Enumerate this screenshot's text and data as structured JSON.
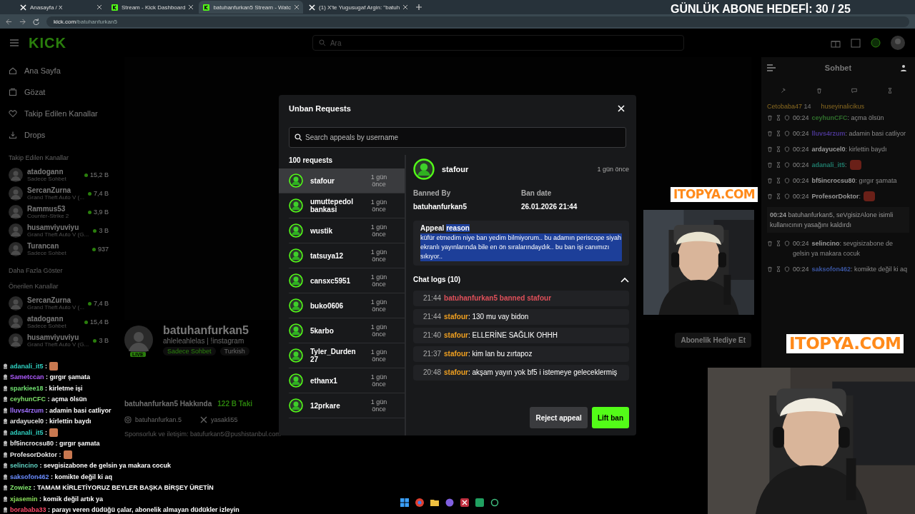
{
  "browser": {
    "tabs": [
      {
        "title": "Anasayfa / X",
        "kind": "x",
        "selected": false
      },
      {
        "title": "Stream - Kick Dashboard",
        "kind": "kick",
        "selected": false
      },
      {
        "title": "batuhanfurkan5 Stream - Watc",
        "kind": "kick",
        "selected": true
      },
      {
        "title": "(1) X'te Yugusugaf Argin: \"batuh",
        "kind": "x",
        "selected": false
      }
    ],
    "url_host": "kick.com",
    "url_path": "/batuhanfurkan5"
  },
  "goal": "GÜNLÜK ABONE HEDEFİ: 30 / 25",
  "header": {
    "logo": "KICK",
    "search_placeholder": "Ara"
  },
  "sidebar": {
    "nav": [
      {
        "label": "Ana Sayfa",
        "kind": "home"
      },
      {
        "label": "Gözat",
        "kind": "browse"
      },
      {
        "label": "Takip Edilen Kanallar",
        "kind": "heart"
      },
      {
        "label": "Drops",
        "kind": "drops"
      }
    ],
    "followed_heading": "Takip Edilen Kanallar",
    "followed": [
      {
        "name": "atadogann",
        "category": "Sadece Sohbet",
        "viewers": "15,2 B"
      },
      {
        "name": "SercanZurna",
        "category": "Grand Theft Auto V (...",
        "viewers": "7,4 B"
      },
      {
        "name": "Rammus53",
        "category": "Counter-Strike 2",
        "viewers": "3,9 B"
      },
      {
        "name": "husamviyuviyu",
        "category": "Grand Theft Auto V (G...",
        "viewers": "3 B"
      },
      {
        "name": "Turancan",
        "category": "Sadece Sohbet",
        "viewers": "937"
      }
    ],
    "show_more": "Daha Fazla Göster",
    "recommended_heading": "Önerilen Kanallar",
    "recommended": [
      {
        "name": "SercanZurna",
        "category": "Grand Theft Auto V (...",
        "viewers": "7,4 B"
      },
      {
        "name": "atadogann",
        "category": "Sadece Sohbet",
        "viewers": "15,4 B"
      },
      {
        "name": "husamviyuviyu",
        "category": "Grand Theft Auto V (G...",
        "viewers": "3 B"
      }
    ]
  },
  "channel": {
    "name": "batuhanfurkan5",
    "live_badge": "LIVE",
    "bio": "ahleleahlelas | !instagram",
    "tags": [
      "Sadece Sohbet",
      "Turkish"
    ],
    "gift_button": "Abonelik Hediye Et",
    "about": "batuhanfurkan5 Hakkında",
    "followers": "122 B Taki",
    "socials": [
      {
        "kind": "instagram",
        "handle": "batuhanfurkan.5"
      },
      {
        "kind": "x",
        "handle": "yasakli55"
      }
    ],
    "sponsor": "Sponsorluk ve iletişim: batufurkan5@pushistanbul.com"
  },
  "chat": {
    "title": "Sohbet",
    "pinned": [
      {
        "name": "Cetobaba47",
        "count": "14"
      },
      {
        "name": "huseyinalicikus"
      }
    ],
    "messages": [
      {
        "kind": "message",
        "time": "00:24",
        "user": "ceyhunCFC",
        "color": "#2f6e2c",
        "text": ": açma ölsün"
      },
      {
        "kind": "message",
        "time": "00:24",
        "user": "lluvs4rzum",
        "color": "#4a3590",
        "text": ": adamin basi catliyor"
      },
      {
        "kind": "message",
        "time": "00:24",
        "user": "ardayucel0",
        "color": "#9a9a9a",
        "text": ": kirlettin baydı"
      },
      {
        "kind": "emote",
        "time": "00:24",
        "user": "adanali_it5",
        "color": "#1f7a6a",
        "text": ":"
      },
      {
        "kind": "message",
        "time": "00:24",
        "user": "bf5incrocsu80",
        "color": "#9a9a9a",
        "text": ": gırgır şamata"
      },
      {
        "kind": "emote",
        "time": "00:24",
        "user": "ProfesorDoktor",
        "color": "#9a9a9a",
        "text": ":"
      },
      {
        "kind": "system",
        "time": "00:24",
        "text": "batuhanfurkan5, seVgisizAlone isimli kullanıcının yasağını kaldırdı"
      },
      {
        "kind": "message",
        "time": "00:24",
        "user": "selincino",
        "color": "#9a9a9a",
        "text": ": sevgisizabone de gelsin ya makara cocuk"
      },
      {
        "kind": "message",
        "time": "00:24",
        "user": "saksofon462",
        "color": "#3a55a0",
        "text": ": komikte değil ki aq"
      }
    ]
  },
  "stream_chat": [
    {
      "user": "adanali_it5",
      "color": "#2fd0c0",
      "kind": "emote",
      "text": ":"
    },
    {
      "user": "Sametccan",
      "color": "#b05cff",
      "kind": "message",
      "text": ": gırgır şamata"
    },
    {
      "user": "sparkiee18",
      "color": "#6fe06f",
      "kind": "message",
      "text": ": kirletme işi"
    },
    {
      "user": "ceyhunCFC",
      "color": "#7ee06a",
      "kind": "message",
      "text": ": açma ölsün"
    },
    {
      "user": "lluvs4rzum",
      "color": "#a070ff",
      "kind": "message",
      "text": ": adamin basi catliyor"
    },
    {
      "user": "ardayucel0",
      "color": "#e8e8e8",
      "kind": "message",
      "text": ": kirlettin baydı"
    },
    {
      "user": "adanali_it5",
      "color": "#2fd0c0",
      "kind": "emote",
      "text": ":"
    },
    {
      "user": "bf5incrocsu80",
      "color": "#e8e8e8",
      "kind": "message",
      "text": ": gırgır şamata"
    },
    {
      "user": "ProfesorDoktor",
      "color": "#e8e8e8",
      "kind": "emote",
      "text": ":"
    },
    {
      "user": "selincino",
      "color": "#5fd0c0",
      "kind": "message",
      "text": ": sevgisizabone de gelsin ya makara cocuk"
    },
    {
      "user": "saksofon462",
      "color": "#6a8cff",
      "kind": "message",
      "text": ": komikte değil ki aq"
    },
    {
      "user": "Zowiez",
      "color": "#7ee06a",
      "kind": "message",
      "text": ": TAMAM KİRLETİYORUZ BEYLER BAŞKA BİRŞEY ÜRETİN"
    },
    {
      "user": "xjasemin",
      "color": "#8be05a",
      "kind": "message",
      "text": ": komik değil artık ya"
    },
    {
      "user": "borababa33",
      "color": "#ff4a6a",
      "kind": "message",
      "text": ": parayı veren düdüğü çalar, abonelik almayan düdükler izleyin"
    }
  ],
  "logos": [
    "ITOPYA.COM",
    "ITOPYA.COM"
  ],
  "webcams": [
    {
      "kind": "picture"
    },
    {
      "kind": "picture"
    }
  ],
  "modal": {
    "title": "Unban Requests",
    "search_placeholder": "Search appeals by username",
    "count": "100 requests",
    "requests": [
      {
        "name": "stafour",
        "time": "1 gün önce",
        "selected": true
      },
      {
        "name": "umuttepedolbankasi",
        "time": "1 gün önce",
        "selected": false
      },
      {
        "name": "wustik",
        "time": "1 gün önce",
        "selected": false
      },
      {
        "name": "tatsuya12",
        "time": "1 gün önce",
        "selected": false
      },
      {
        "name": "cansxc5951",
        "time": "1 gün önce",
        "selected": false
      },
      {
        "name": "buko0606",
        "time": "1 gün önce",
        "selected": false
      },
      {
        "name": "5karbo",
        "time": "1 gün önce",
        "selected": false
      },
      {
        "name": "Tyler_Durden27",
        "time": "1 gün önce",
        "selected": false
      },
      {
        "name": "ethanx1",
        "time": "1 gün önce",
        "selected": false
      },
      {
        "name": "12prkare",
        "time": "1 gün önce",
        "selected": false
      }
    ],
    "detail": {
      "user": "stafour",
      "time": "1 gün önce",
      "banned_by_label": "Banned By",
      "banned_by": "batuhanfurkan5",
      "ban_date_label": "Ban date",
      "ban_date": "26.01.2026 21:44",
      "appeal_heading": "Appeal **reason**",
      "appeal_text": "küfür etmedim niye ban yedim bilmiyorum.. bu adamın periscope siyah ekranlı yayınlarında bile en ön sıralarındaydık.. bu ban işi canımızı sıkıyor..",
      "appeal_highlighted": true,
      "logs_heading": "Chat logs (10)",
      "logs_expanded": true,
      "logs": [
        {
          "kind": "ban",
          "time": "21:44",
          "text": "batuhanfurkan5 banned stafour"
        },
        {
          "kind": "message",
          "time": "21:44",
          "user": "stafour",
          "text": ": 130 mu vay bidon"
        },
        {
          "kind": "message",
          "time": "21:40",
          "user": "stafour",
          "text": ": ELLERİNE SAĞLIK OHHH"
        },
        {
          "kind": "message",
          "time": "21:37",
          "user": "stafour",
          "text": ": kim lan bu zırtapoz"
        },
        {
          "kind": "message",
          "time": "20:48",
          "user": "stafour",
          "text": ": akşam yayın yok bf5 i istemeye geleceklermiş"
        }
      ]
    },
    "buttons": [
      {
        "label": "Reject appeal",
        "kind": "secondary"
      },
      {
        "label": "Lift ban",
        "kind": "primary"
      }
    ]
  }
}
